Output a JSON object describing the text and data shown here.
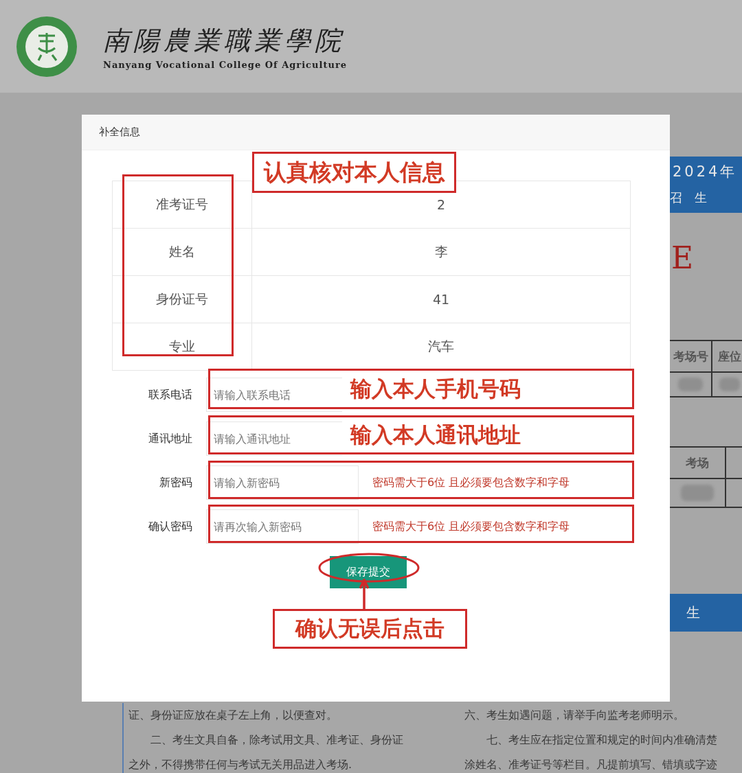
{
  "header": {
    "title_cn": "南陽農業職業學院",
    "title_en": "Nanyang Vocational College Of Agriculture"
  },
  "background_page": {
    "banner_year": "2024年",
    "banner_sub": "召 生",
    "red_mark": "E",
    "table_1_headers": [
      "考场号",
      "座位"
    ],
    "table_2_headers": [
      "考场"
    ],
    "banner_bottom": "生",
    "left_lines": [
      "证、身份证应放在桌子左上角，以便查对。",
      "　　二、考生文具自备，除考试用文具、准考证、身份证",
      "之外，不得携带任何与考试无关用品进入考场."
    ],
    "right_lines": [
      "六、考生如遇问题，请举手向监考老师明示。",
      "　　七、考生应在指定位置和规定的时间内准确清楚",
      "涂姓名、准考证号等栏目。凡提前填写、错填或字迹"
    ]
  },
  "dialog": {
    "title": "补全信息",
    "info_rows": [
      {
        "label": "准考证号",
        "value": "2"
      },
      {
        "label": "姓名",
        "value": "李"
      },
      {
        "label": "身份证号",
        "value": "41"
      },
      {
        "label": "专业",
        "value": "汽车"
      }
    ],
    "form_rows": [
      {
        "kind": "text",
        "label": "联系电话",
        "placeholder": "请输入联系电话"
      },
      {
        "kind": "text",
        "label": "通讯地址",
        "placeholder": "请输入通讯地址"
      },
      {
        "kind": "password",
        "label": "新密码",
        "placeholder": "请输入新密码",
        "hint": "密码需大于6位 且必须要包含数字和字母"
      },
      {
        "kind": "password",
        "label": "确认密码",
        "placeholder": "请再次输入新密码",
        "hint": "密码需大于6位 且必须要包含数字和字母"
      }
    ],
    "submit_button": "保存提交"
  },
  "annotations": {
    "check_info": "认真核对本人信息",
    "phone_note": "输入本人手机号码",
    "address_note": "输入本人通讯地址",
    "click_note": "确认无误后点击"
  }
}
